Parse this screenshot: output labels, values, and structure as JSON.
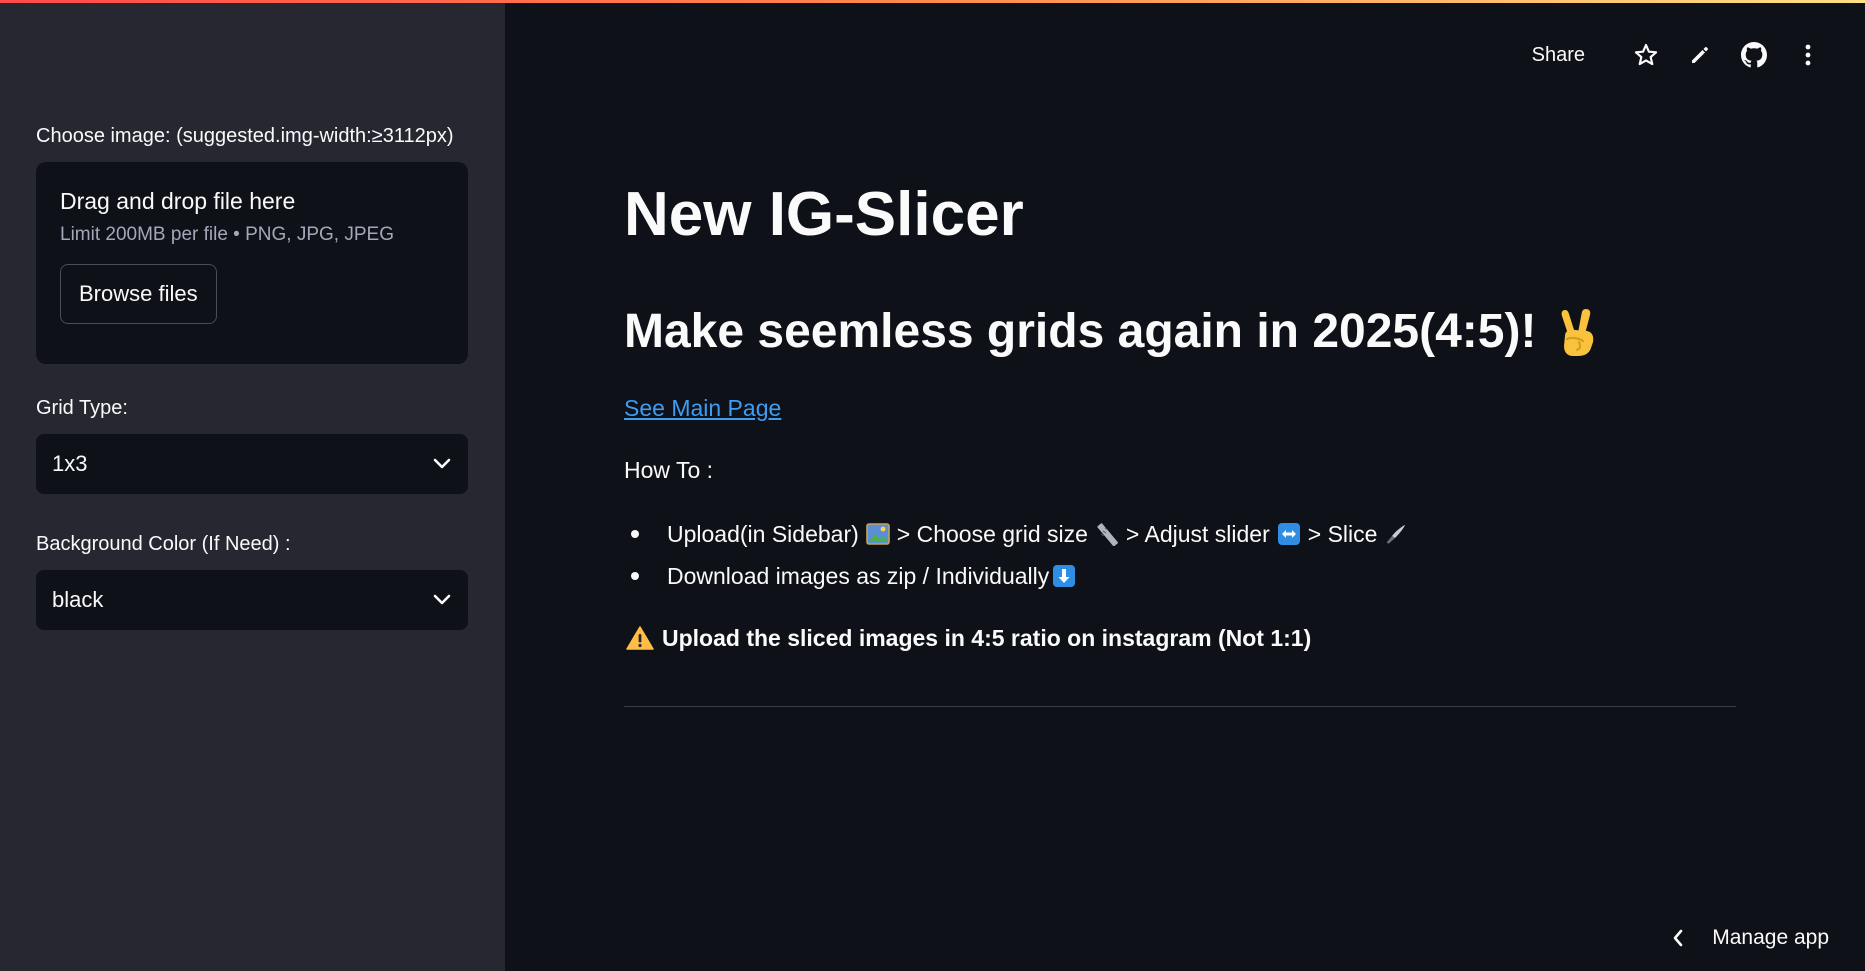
{
  "sidebar": {
    "uploader": {
      "label": "Choose image: (suggested.img-width:≥3112px)",
      "dropzone_title": "Drag and drop file here",
      "dropzone_limit": "Limit 200MB per file • PNG, JPG, JPEG",
      "browse_label": "Browse files"
    },
    "grid_type": {
      "label": "Grid Type:",
      "selected": "1x3"
    },
    "background_color": {
      "label": "Background Color (If Need) :",
      "selected": "black"
    }
  },
  "header": {
    "share_label": "Share",
    "icons": [
      "star-icon",
      "edit-icon",
      "github-icon",
      "more-vertical-icon"
    ]
  },
  "main": {
    "title": "New IG-Slicer",
    "subtitle": "Make seemless grids again in 2025(4:5)!",
    "subtitle_emoji": "✌️",
    "link_label": "See Main Page",
    "howto_label": "How To :",
    "steps": [
      {
        "parts": [
          "Upload(in Sidebar)",
          "> Choose grid size",
          "> Adjust slider",
          "> Slice"
        ],
        "emojis": [
          "🖼️",
          "📏",
          "↔️",
          "🔪"
        ]
      },
      {
        "text": "Download images as zip / Individually",
        "emoji": "⬇️"
      }
    ],
    "warning_text": "Upload the sliced images in 4:5 ratio on instagram (Not 1:1)"
  },
  "footer": {
    "manage_app_label": "Manage app"
  },
  "colors": {
    "app_background": "#0e1117",
    "sidebar_background": "#262730",
    "link": "#3d9df3",
    "warning": "#ffbd45",
    "accent_stripe_start": "#ff4b4b",
    "accent_stripe_end": "#ffe082"
  }
}
